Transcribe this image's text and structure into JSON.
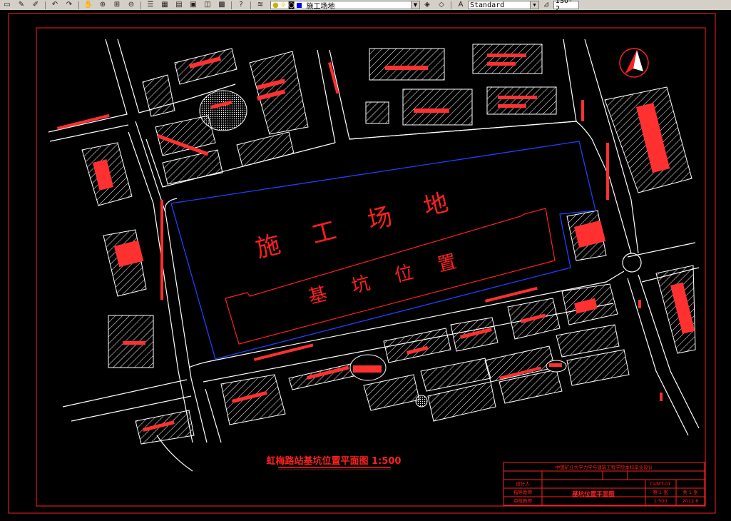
{
  "toolbar": {
    "layer_name": "施工场地",
    "text_style": "Standard",
    "iso_label": "ISO-2",
    "help_label": "?"
  },
  "drawing": {
    "site_label": "施 工 场 地",
    "pit_label": "基 坑 位 置",
    "title": "虹梅路站基坑位置平面图 1:500",
    "north_label": "N"
  },
  "title_block": {
    "university": "中国矿业大学力学与建筑工程学院本科毕业设计",
    "drawing_name": "基坑位置平面图",
    "designer": "设计人",
    "checker": "指导教师",
    "reviewer": "审核教师",
    "scale": "1:500",
    "sheet": "第 1 张",
    "total": "共 1 张",
    "drawing_no": "CUMT-01",
    "date": "2012.6"
  }
}
